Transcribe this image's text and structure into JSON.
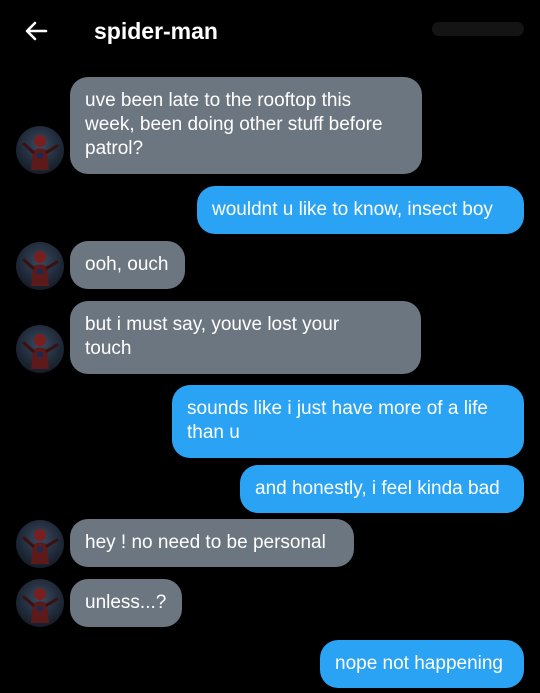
{
  "header": {
    "title": "spider-man"
  },
  "messages": [
    {
      "text": "uve been late to the rooftop this\nweek, been doing other stuff before\npatrol?"
    },
    {
      "text": "wouldnt u like to know, insect boy"
    },
    {
      "text": "ooh, ouch"
    },
    {
      "text": "but i must say, youve lost your\ntouch"
    },
    {
      "text": "sounds like i just have more of a life\nthan u"
    },
    {
      "text": "and honestly, i feel kinda bad"
    },
    {
      "text": "hey ! no need to be personal"
    },
    {
      "text": "unless...?"
    },
    {
      "text": "nope not happening"
    }
  ],
  "colors": {
    "incoming": "#6c7680",
    "outgoing": "#2aa3f5",
    "background": "#000000"
  }
}
